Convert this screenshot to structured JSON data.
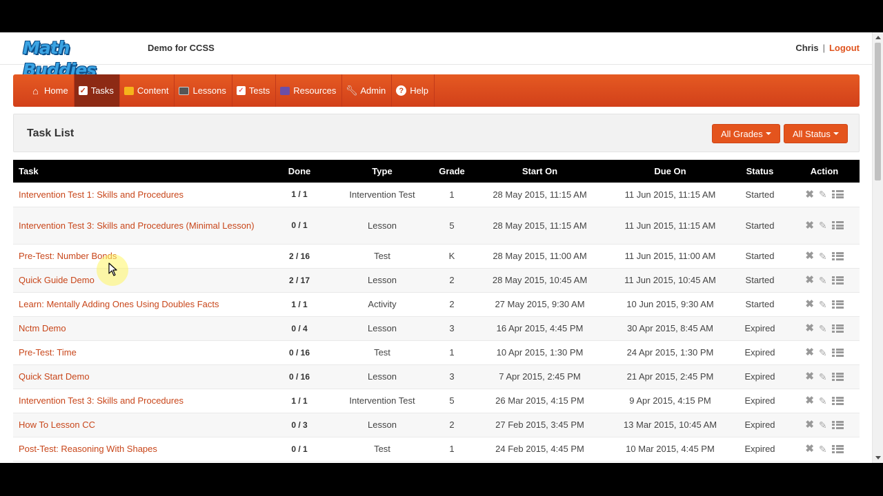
{
  "header": {
    "logo": "Math Buddies",
    "app_name": "Demo for CCSS",
    "user": "Chris",
    "separator": "|",
    "logout": "Logout"
  },
  "nav": {
    "items": [
      {
        "label": "Home",
        "icon": "home-icon"
      },
      {
        "label": "Tasks",
        "icon": "check-icon",
        "active": true
      },
      {
        "label": "Content",
        "icon": "content-icon"
      },
      {
        "label": "Lessons",
        "icon": "lessons-icon"
      },
      {
        "label": "Tests",
        "icon": "tests-icon"
      },
      {
        "label": "Resources",
        "icon": "resources-icon"
      },
      {
        "label": "Admin",
        "icon": "wrench-icon"
      },
      {
        "label": "Help",
        "icon": "help-icon"
      }
    ]
  },
  "panel": {
    "title": "Task List",
    "grades_button": "All Grades",
    "status_button": "All Status"
  },
  "table": {
    "columns": [
      "Task",
      "Done",
      "Type",
      "Grade",
      "Start On",
      "Due On",
      "Status",
      "Action"
    ],
    "rows": [
      {
        "task": "Intervention Test 1: Skills and Procedures",
        "done": "1 / 1",
        "type": "Intervention Test",
        "grade": "1",
        "start": "28 May 2015, 11:15 AM",
        "due": "11 Jun 2015, 11:15 AM",
        "status": "Started"
      },
      {
        "task": "Intervention Test 3: Skills and Procedures (Minimal Lesson)",
        "done": "0 / 1",
        "type": "Lesson",
        "grade": "5",
        "start": "28 May 2015, 11:15 AM",
        "due": "11 Jun 2015, 11:15 AM",
        "status": "Started"
      },
      {
        "task": "Pre-Test: Number Bonds",
        "done": "2 / 16",
        "type": "Test",
        "grade": "K",
        "start": "28 May 2015, 11:00 AM",
        "due": "11 Jun 2015, 11:00 AM",
        "status": "Started"
      },
      {
        "task": "Quick Guide Demo",
        "done": "2 / 17",
        "type": "Lesson",
        "grade": "2",
        "start": "28 May 2015, 10:45 AM",
        "due": "11 Jun 2015, 10:45 AM",
        "status": "Started"
      },
      {
        "task": "Learn: Mentally Adding Ones Using Doubles Facts",
        "done": "1 / 1",
        "type": "Activity",
        "grade": "2",
        "start": "27 May 2015, 9:30 AM",
        "due": "10 Jun 2015, 9:30 AM",
        "status": "Started"
      },
      {
        "task": "Nctm Demo",
        "done": "0 / 4",
        "type": "Lesson",
        "grade": "3",
        "start": "16 Apr 2015, 4:45 PM",
        "due": "30 Apr 2015, 8:45 AM",
        "status": "Expired"
      },
      {
        "task": "Pre-Test: Time",
        "done": "0 / 16",
        "type": "Test",
        "grade": "1",
        "start": "10 Apr 2015, 1:30 PM",
        "due": "24 Apr 2015, 1:30 PM",
        "status": "Expired"
      },
      {
        "task": "Quick Start Demo",
        "done": "0 / 16",
        "type": "Lesson",
        "grade": "3",
        "start": "7 Apr 2015, 2:45 PM",
        "due": "21 Apr 2015, 2:45 PM",
        "status": "Expired"
      },
      {
        "task": "Intervention Test 3: Skills and Procedures",
        "done": "1 / 1",
        "type": "Intervention Test",
        "grade": "5",
        "start": "26 Mar 2015, 4:15 PM",
        "due": "9 Apr 2015, 4:15 PM",
        "status": "Expired"
      },
      {
        "task": "How To Lesson CC",
        "done": "0 / 3",
        "type": "Lesson",
        "grade": "2",
        "start": "27 Feb 2015, 3:45 PM",
        "due": "13 Mar 2015, 10:45 AM",
        "status": "Expired"
      },
      {
        "task": "Post-Test: Reasoning With Shapes",
        "done": "0 / 1",
        "type": "Test",
        "grade": "1",
        "start": "24 Feb 2015, 4:45 PM",
        "due": "10 Mar 2015, 4:45 PM",
        "status": "Expired"
      }
    ]
  },
  "colors": {
    "brand_orange": "#e4541d",
    "nav_active": "#8d2a14",
    "link": "#c8461a"
  }
}
